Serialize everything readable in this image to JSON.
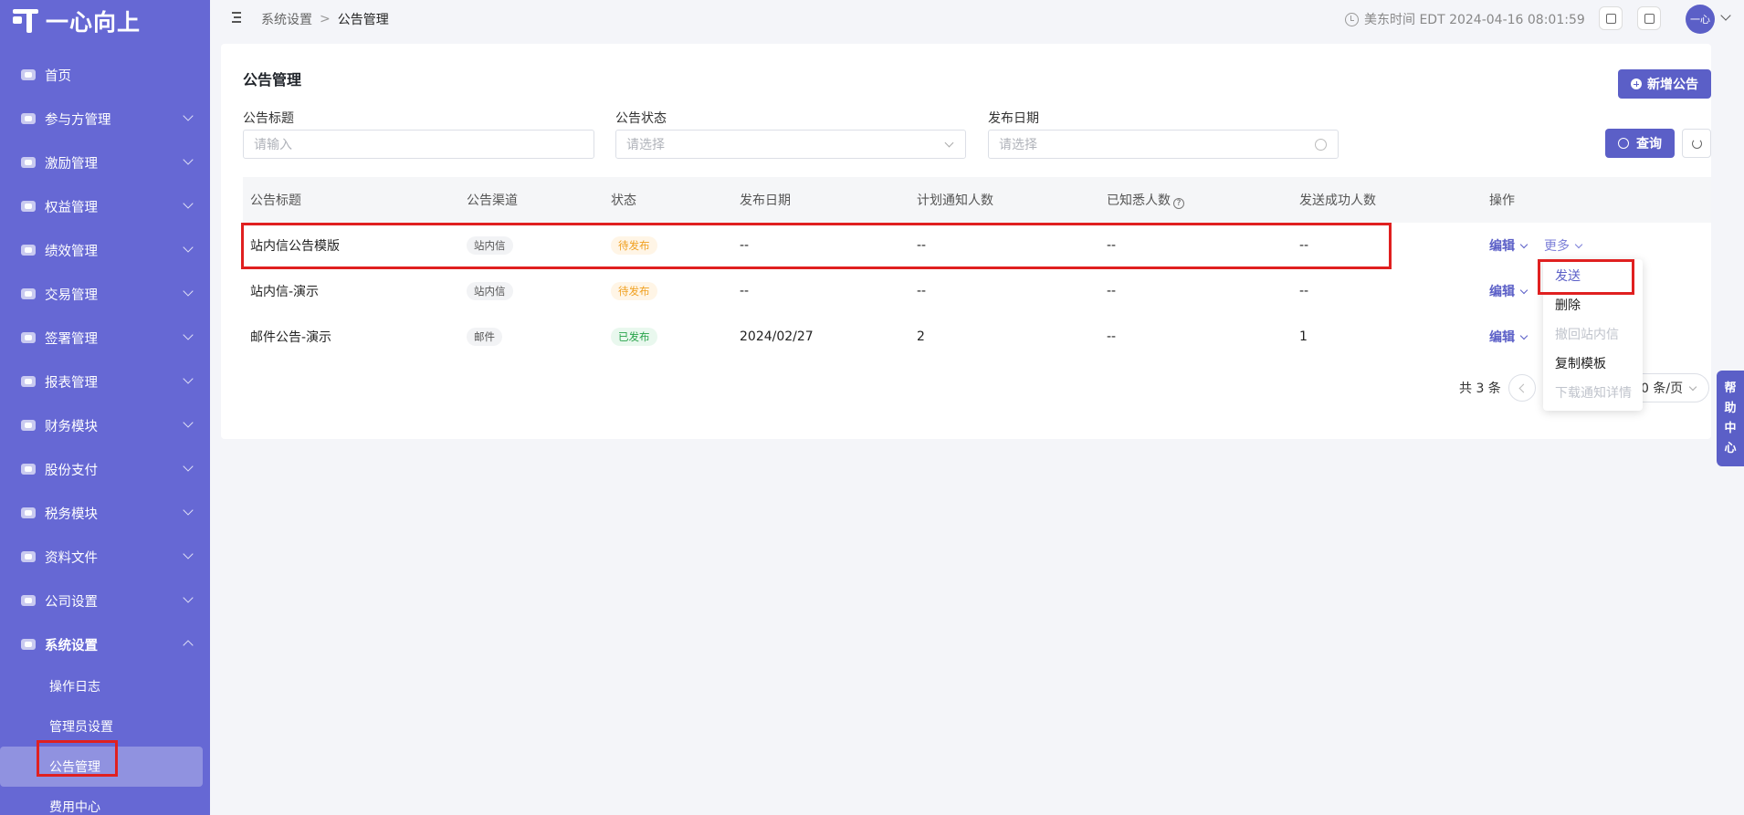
{
  "brand": {
    "name": "一心向上"
  },
  "sidebar": {
    "items": [
      {
        "label": "首页",
        "icon": "home-icon"
      },
      {
        "label": "参与方管理",
        "icon": "participants-icon"
      },
      {
        "label": "激励管理",
        "icon": "incentive-icon"
      },
      {
        "label": "权益管理",
        "icon": "equity-icon"
      },
      {
        "label": "绩效管理",
        "icon": "performance-icon"
      },
      {
        "label": "交易管理",
        "icon": "trade-icon"
      },
      {
        "label": "签署管理",
        "icon": "sign-icon"
      },
      {
        "label": "报表管理",
        "icon": "report-icon"
      },
      {
        "label": "财务模块",
        "icon": "finance-icon"
      },
      {
        "label": "股份支付",
        "icon": "share-payment-icon"
      },
      {
        "label": "税务模块",
        "icon": "tax-icon"
      },
      {
        "label": "资料文件",
        "icon": "files-icon"
      },
      {
        "label": "公司设置",
        "icon": "company-icon"
      },
      {
        "label": "系统设置",
        "icon": "system-icon"
      }
    ],
    "subitems": [
      {
        "label": "操作日志"
      },
      {
        "label": "管理员设置"
      },
      {
        "label": "公告管理"
      },
      {
        "label": "费用中心"
      }
    ]
  },
  "header": {
    "breadcrumb": {
      "parent": "系统设置",
      "separator": ">",
      "current": "公告管理"
    },
    "time": "美东时间 EDT 2024-04-16 08:01:59",
    "avatar": "一心"
  },
  "page": {
    "title": "公告管理",
    "add_button": "新增公告",
    "query_button": "查询"
  },
  "filters": {
    "title": {
      "label": "公告标题",
      "placeholder": "请输入"
    },
    "status": {
      "label": "公告状态",
      "placeholder": "请选择"
    },
    "date": {
      "label": "发布日期",
      "placeholder": "请选择"
    }
  },
  "table": {
    "headers": [
      "公告标题",
      "公告渠道",
      "状态",
      "发布日期",
      "计划通知人数",
      "已知悉人数",
      "发送成功人数",
      "操作"
    ],
    "help_mark": "?",
    "rows": [
      {
        "title": "站内信公告模版",
        "channel": "站内信",
        "status": "待发布",
        "date": "--",
        "planned": "--",
        "known": "--",
        "success": "--",
        "edit": "编辑",
        "more": "更多"
      },
      {
        "title": "站内信-演示",
        "channel": "站内信",
        "status": "待发布",
        "date": "--",
        "planned": "--",
        "known": "--",
        "success": "--",
        "edit": "编辑",
        "more": ""
      },
      {
        "title": "邮件公告-演示",
        "channel": "邮件",
        "status": "已发布",
        "date": "2024/02/27",
        "planned": "2",
        "known": "--",
        "success": "1",
        "edit": "编辑",
        "more": ""
      }
    ]
  },
  "dropdown": {
    "items": [
      {
        "label": "发送"
      },
      {
        "label": "删除"
      },
      {
        "label": "撤回站内信"
      },
      {
        "label": "复制模板"
      },
      {
        "label": "下载通知详情"
      }
    ]
  },
  "pagination": {
    "total": "共 3 条",
    "page_size": "0 条/页"
  },
  "help_center": {
    "chars": [
      "帮",
      "助",
      "中",
      "心"
    ]
  },
  "colors": {
    "accent": "#5b5fc7",
    "sidebar": "#6668d4",
    "highlight": "#e02020"
  }
}
